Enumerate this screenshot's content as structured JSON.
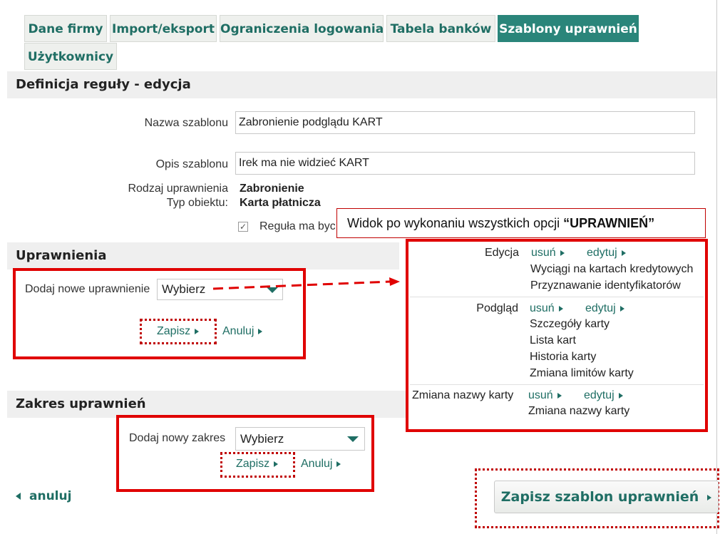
{
  "tabs": [
    {
      "label": "Dane firmy",
      "active": false
    },
    {
      "label": "Import/eksport",
      "active": false
    },
    {
      "label": "Ograniczenia logowania",
      "active": false
    },
    {
      "label": "Tabela banków",
      "active": false
    },
    {
      "label": "Szablony uprawnień",
      "active": true
    },
    {
      "label": "Użytkownicy",
      "active": false
    }
  ],
  "rule_section": {
    "title": "Definicja reguły - edycja",
    "name_label": "Nazwa szablonu",
    "name_value": "Zabronienie podglądu KART",
    "desc_label": "Opis szablonu",
    "desc_value": "Irek ma nie widzieć KART",
    "right_type_label": "Rodzaj uprawnienia",
    "right_type_value": "Zabronienie",
    "object_type_label": "Typ obiektu:",
    "object_type_value": "Karta płatnicza",
    "checkbox_label": "Reguła ma byc"
  },
  "permissions_section": {
    "title": "Uprawnienia",
    "add_label": "Dodaj nowe uprawnienie",
    "select_value": "Wybierz",
    "save_label": "Zapisz",
    "cancel_label": "Anuluj"
  },
  "scope_section": {
    "title": "Zakres uprawnień",
    "add_label": "Dodaj nowy zakres",
    "select_value": "Wybierz",
    "save_label": "Zapisz",
    "cancel_label": "Anuluj"
  },
  "callout": {
    "text": "Widok po wykonaniu wszystkich opcji ",
    "bold": "“UPRAWNIEŃ”"
  },
  "permissions_view": {
    "groups": [
      {
        "name": "Edycja",
        "remove": "usuń",
        "edit": "edytuj",
        "items": [
          "Wyciągi na kartach kredytowych",
          "Przyznawanie identyfikatorów"
        ]
      },
      {
        "name": "Podgląd",
        "remove": "usuń",
        "edit": "edytuj",
        "items": [
          "Szczegóły karty",
          "Lista kart",
          "Historia karty",
          "Zmiana limitów karty"
        ]
      },
      {
        "name": "Zmiana nazwy karty",
        "remove": "usuń",
        "edit": "edytuj",
        "items": [
          "Zmiana nazwy karty"
        ]
      }
    ]
  },
  "footer": {
    "back_label": "anuluj",
    "save_template_label": "Zapisz szablon uprawnień"
  },
  "colors": {
    "accent": "#2a857a",
    "link": "#1f6e64",
    "annotation_red": "#e00000"
  }
}
